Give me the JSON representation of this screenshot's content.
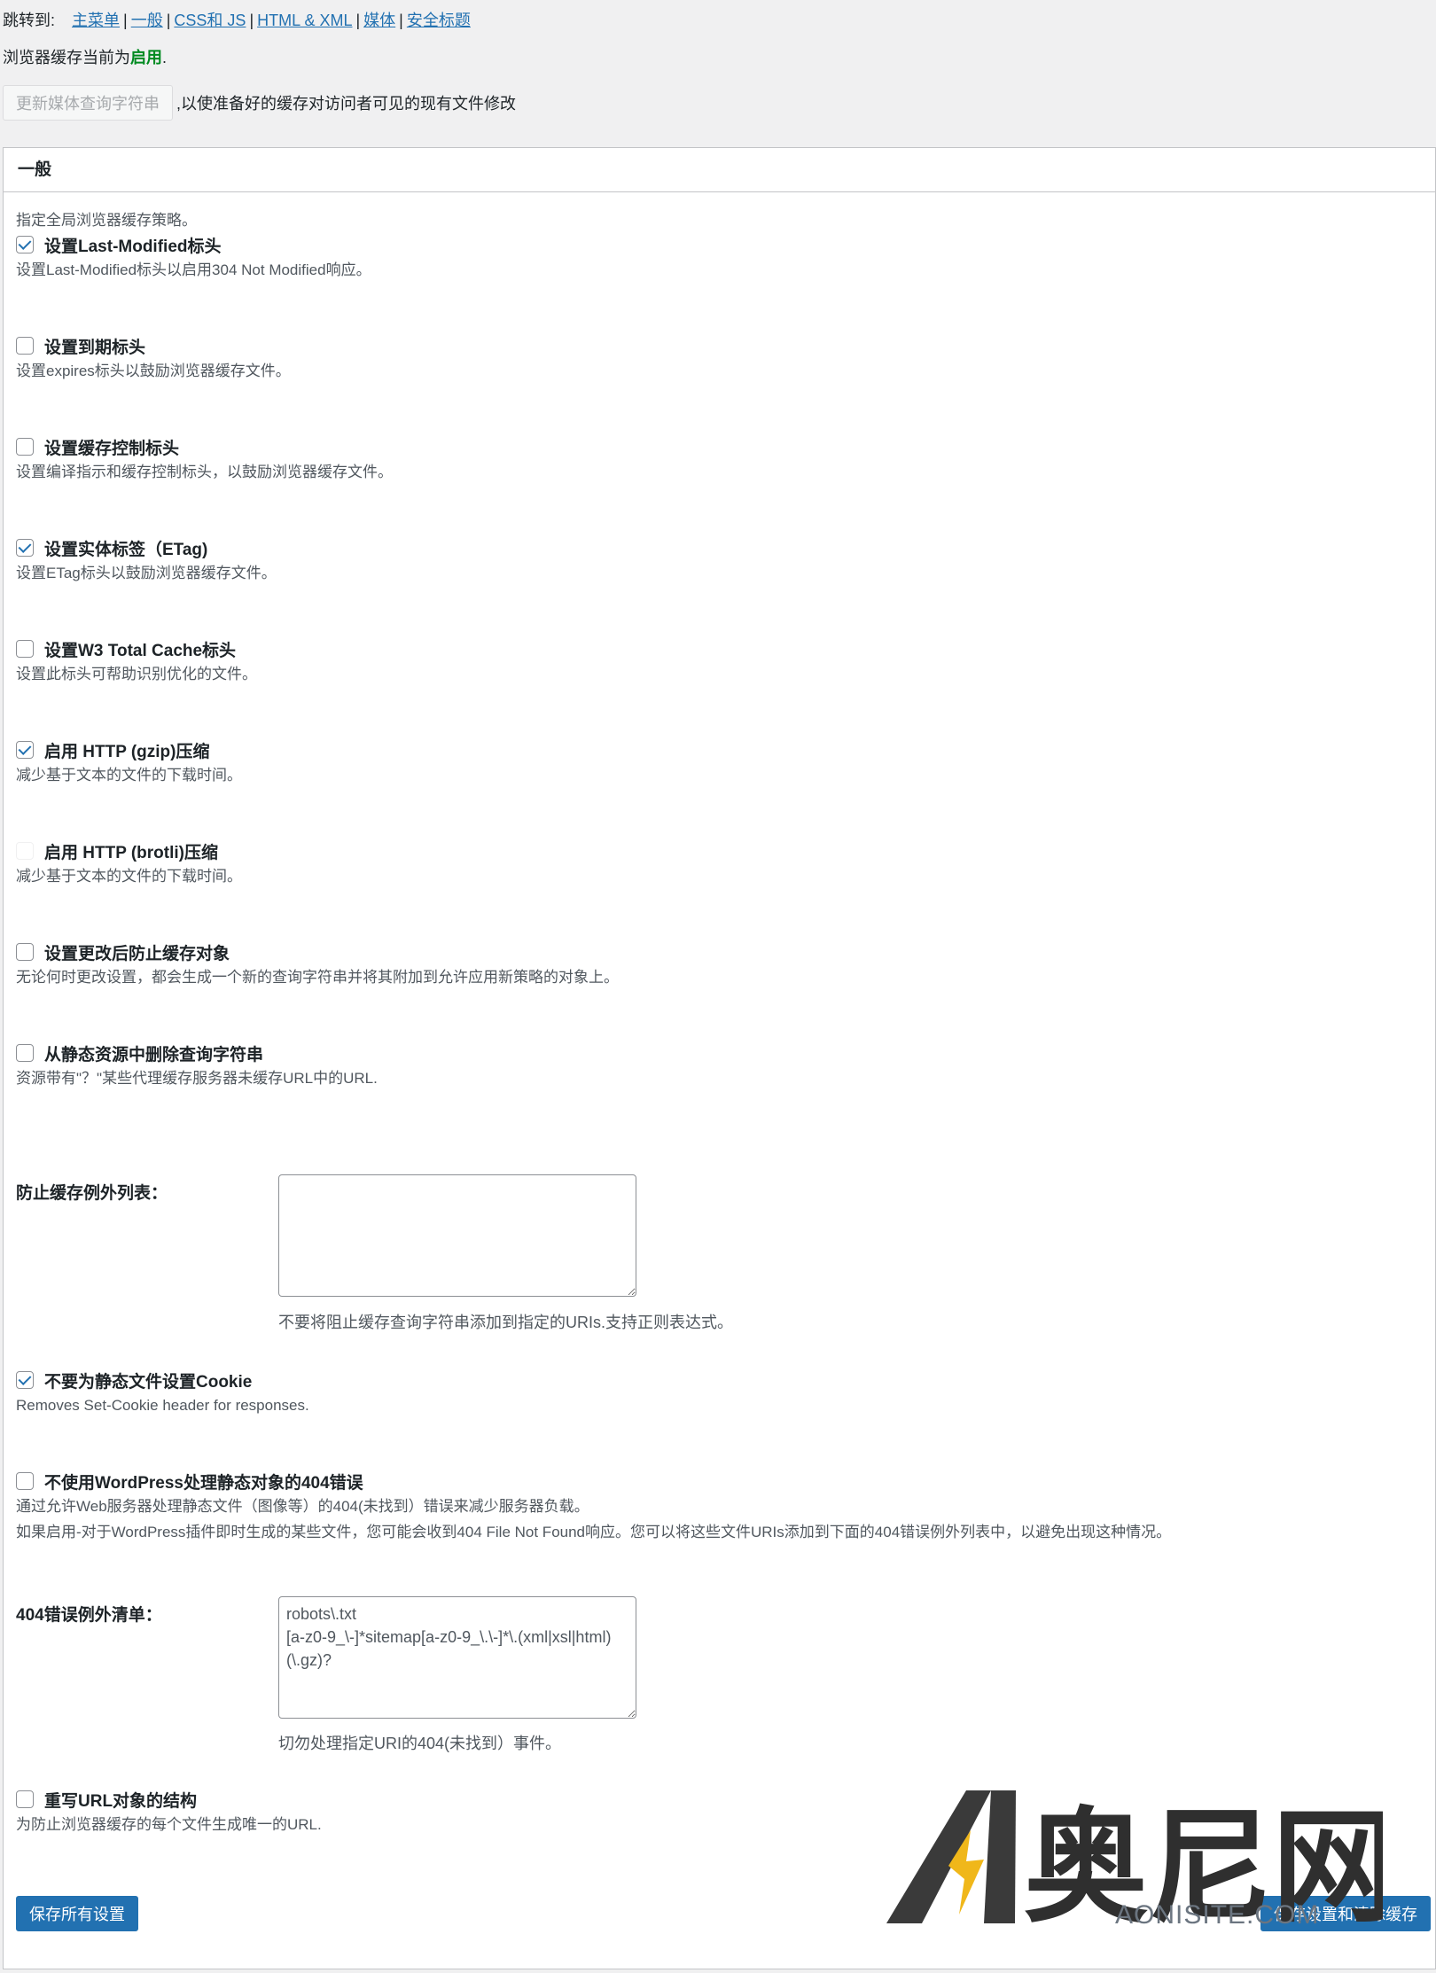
{
  "top": {
    "jump_label": "跳转到:",
    "links": [
      "主菜单",
      "一般",
      "CSS和 JS",
      "HTML & XML",
      "媒体",
      "安全标题"
    ],
    "status_prefix": "浏览器缓存当前为",
    "status_value": "启用",
    "status_suffix": ".",
    "media_button": "更新媒体查询字符串",
    "media_text": ",以使准备好的缓存对访问者可见的现有文件修改"
  },
  "panel": {
    "title": "一般",
    "intro": "指定全局浏览器缓存策略。"
  },
  "options": [
    {
      "title": "设置Last-Modified标头",
      "desc": "设置Last-Modified标头以启用304 Not Modified响应。",
      "checked": true
    },
    {
      "title": "设置到期标头",
      "desc": "设置expires标头以鼓励浏览器缓存文件。",
      "checked": false
    },
    {
      "title": "设置缓存控制标头",
      "desc": "设置编译指示和缓存控制标头，以鼓励浏览器缓存文件。",
      "checked": false
    },
    {
      "title": "设置实体标签（ETag)",
      "desc": "设置ETag标头以鼓励浏览器缓存文件。",
      "checked": true
    },
    {
      "title": "设置W3 Total Cache标头",
      "desc": "设置此标头可帮助识别优化的文件。",
      "checked": false
    },
    {
      "title": "启用 HTTP (gzip)压缩",
      "desc": "减少基于文本的文件的下载时间。",
      "checked": true
    },
    {
      "title": "启用 HTTP (brotli)压缩",
      "desc": "减少基于文本的文件的下载时间。",
      "checked": false,
      "disabled": true
    },
    {
      "title": "设置更改后防止缓存对象",
      "desc": "无论何时更改设置，都会生成一个新的查询字符串并将其附加到允许应用新策略的对象上。",
      "checked": false
    },
    {
      "title": "从静态资源中删除查询字符串",
      "desc": "资源带有\"？\"某些代理缓存服务器未缓存URL中的URL.",
      "checked": false
    }
  ],
  "exceptions_field": {
    "label": "防止缓存例外列表：",
    "value": "",
    "desc": "不要将阻止缓存查询字符串添加到指定的URIs.支持正则表达式。"
  },
  "options2": [
    {
      "title": "不要为静态文件设置Cookie",
      "desc": "Removes Set-Cookie header for responses.",
      "checked": true
    },
    {
      "title": "不使用WordPress处理静态对象的404错误",
      "desc": "通过允许Web服务器处理静态文件（图像等）的404(未找到）错误来减少服务器负载。",
      "desc2": "如果启用-对于WordPress插件即时生成的某些文件，您可能会收到404 File Not Found响应。您可以将这些文件URIs添加到下面的404错误例外列表中，以避免出现这种情况。",
      "checked": false
    }
  ],
  "notfound_field": {
    "label": "404错误例外清单：",
    "value": "robots\\.txt\n[a-z0-9_\\-]*sitemap[a-z0-9_\\.\\-]*\\.(xml|xsl|html)(\\.gz)?",
    "desc": "切勿处理指定URI的404(未找到）事件。"
  },
  "options3": [
    {
      "title": "重写URL对象的结构",
      "desc": "为防止浏览器缓存的每个文件生成唯一的URL.",
      "checked": false
    }
  ],
  "buttons": {
    "save_all": "保存所有设置",
    "save_clear": "保存设置和清除缓存"
  },
  "watermark": {
    "cn": "奥尼网",
    "en": "AONISITE.COM"
  },
  "colors": {
    "accent": "#2271b1",
    "enabled": "#008a20",
    "bolt": "#f0b71a"
  }
}
